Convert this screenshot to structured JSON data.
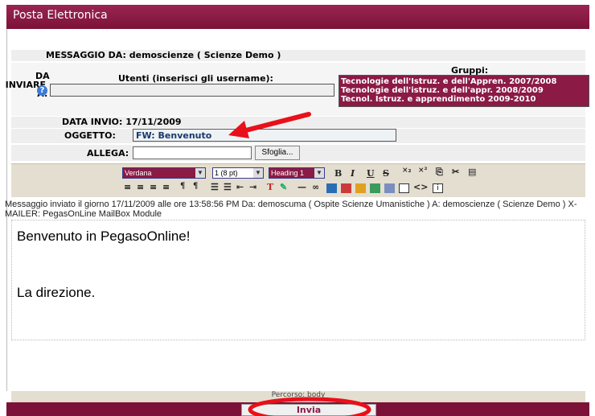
{
  "header": {
    "title": "Posta Elettronica"
  },
  "from_label": "MESSAGGIO DA: demoscienze ( Scienze Demo )",
  "to": {
    "label_line1": "DA",
    "label_line2": "INVIARE",
    "label_line3": "A:",
    "users_label": "Utenti (inserisci gli username):",
    "groups_label": "Gruppi:",
    "groups": [
      "Tecnologie dell'Istruz. e dell'Appren. 2007/2008",
      "Tecnologie dell'istruz. e dell'appr. 2008/2009",
      "Tecnol. Istruz. e apprendimento 2009-2010"
    ]
  },
  "date": {
    "label": "DATA INVIO: 17/11/2009"
  },
  "subject": {
    "label": "OGGETTO:",
    "value": "FW: Benvenuto"
  },
  "attach": {
    "label": "ALLEGA:",
    "browse": "Sfoglia..."
  },
  "toolbar": {
    "font": "Verdana",
    "size": "1 (8 pt)",
    "format": "Heading 1",
    "bold": "B",
    "italic": "I",
    "underline": "U",
    "strike": "S"
  },
  "message_header": "Messaggio inviato il giorno 17/11/2009 alle ore 13:58:56 PM Da: demoscuma ( Ospite Scienze Umanistiche ) A: demoscienze ( Scienze Demo ) X-MAILER: PegasOnLine MailBox Module",
  "body": {
    "line1": "Benvenuto in PegasoOnline!",
    "line2": "La direzione."
  },
  "status": "Percorso: body",
  "send_button": "Invia",
  "colors": {
    "brand": "#8b1a45",
    "annotation": "#e8101a"
  }
}
